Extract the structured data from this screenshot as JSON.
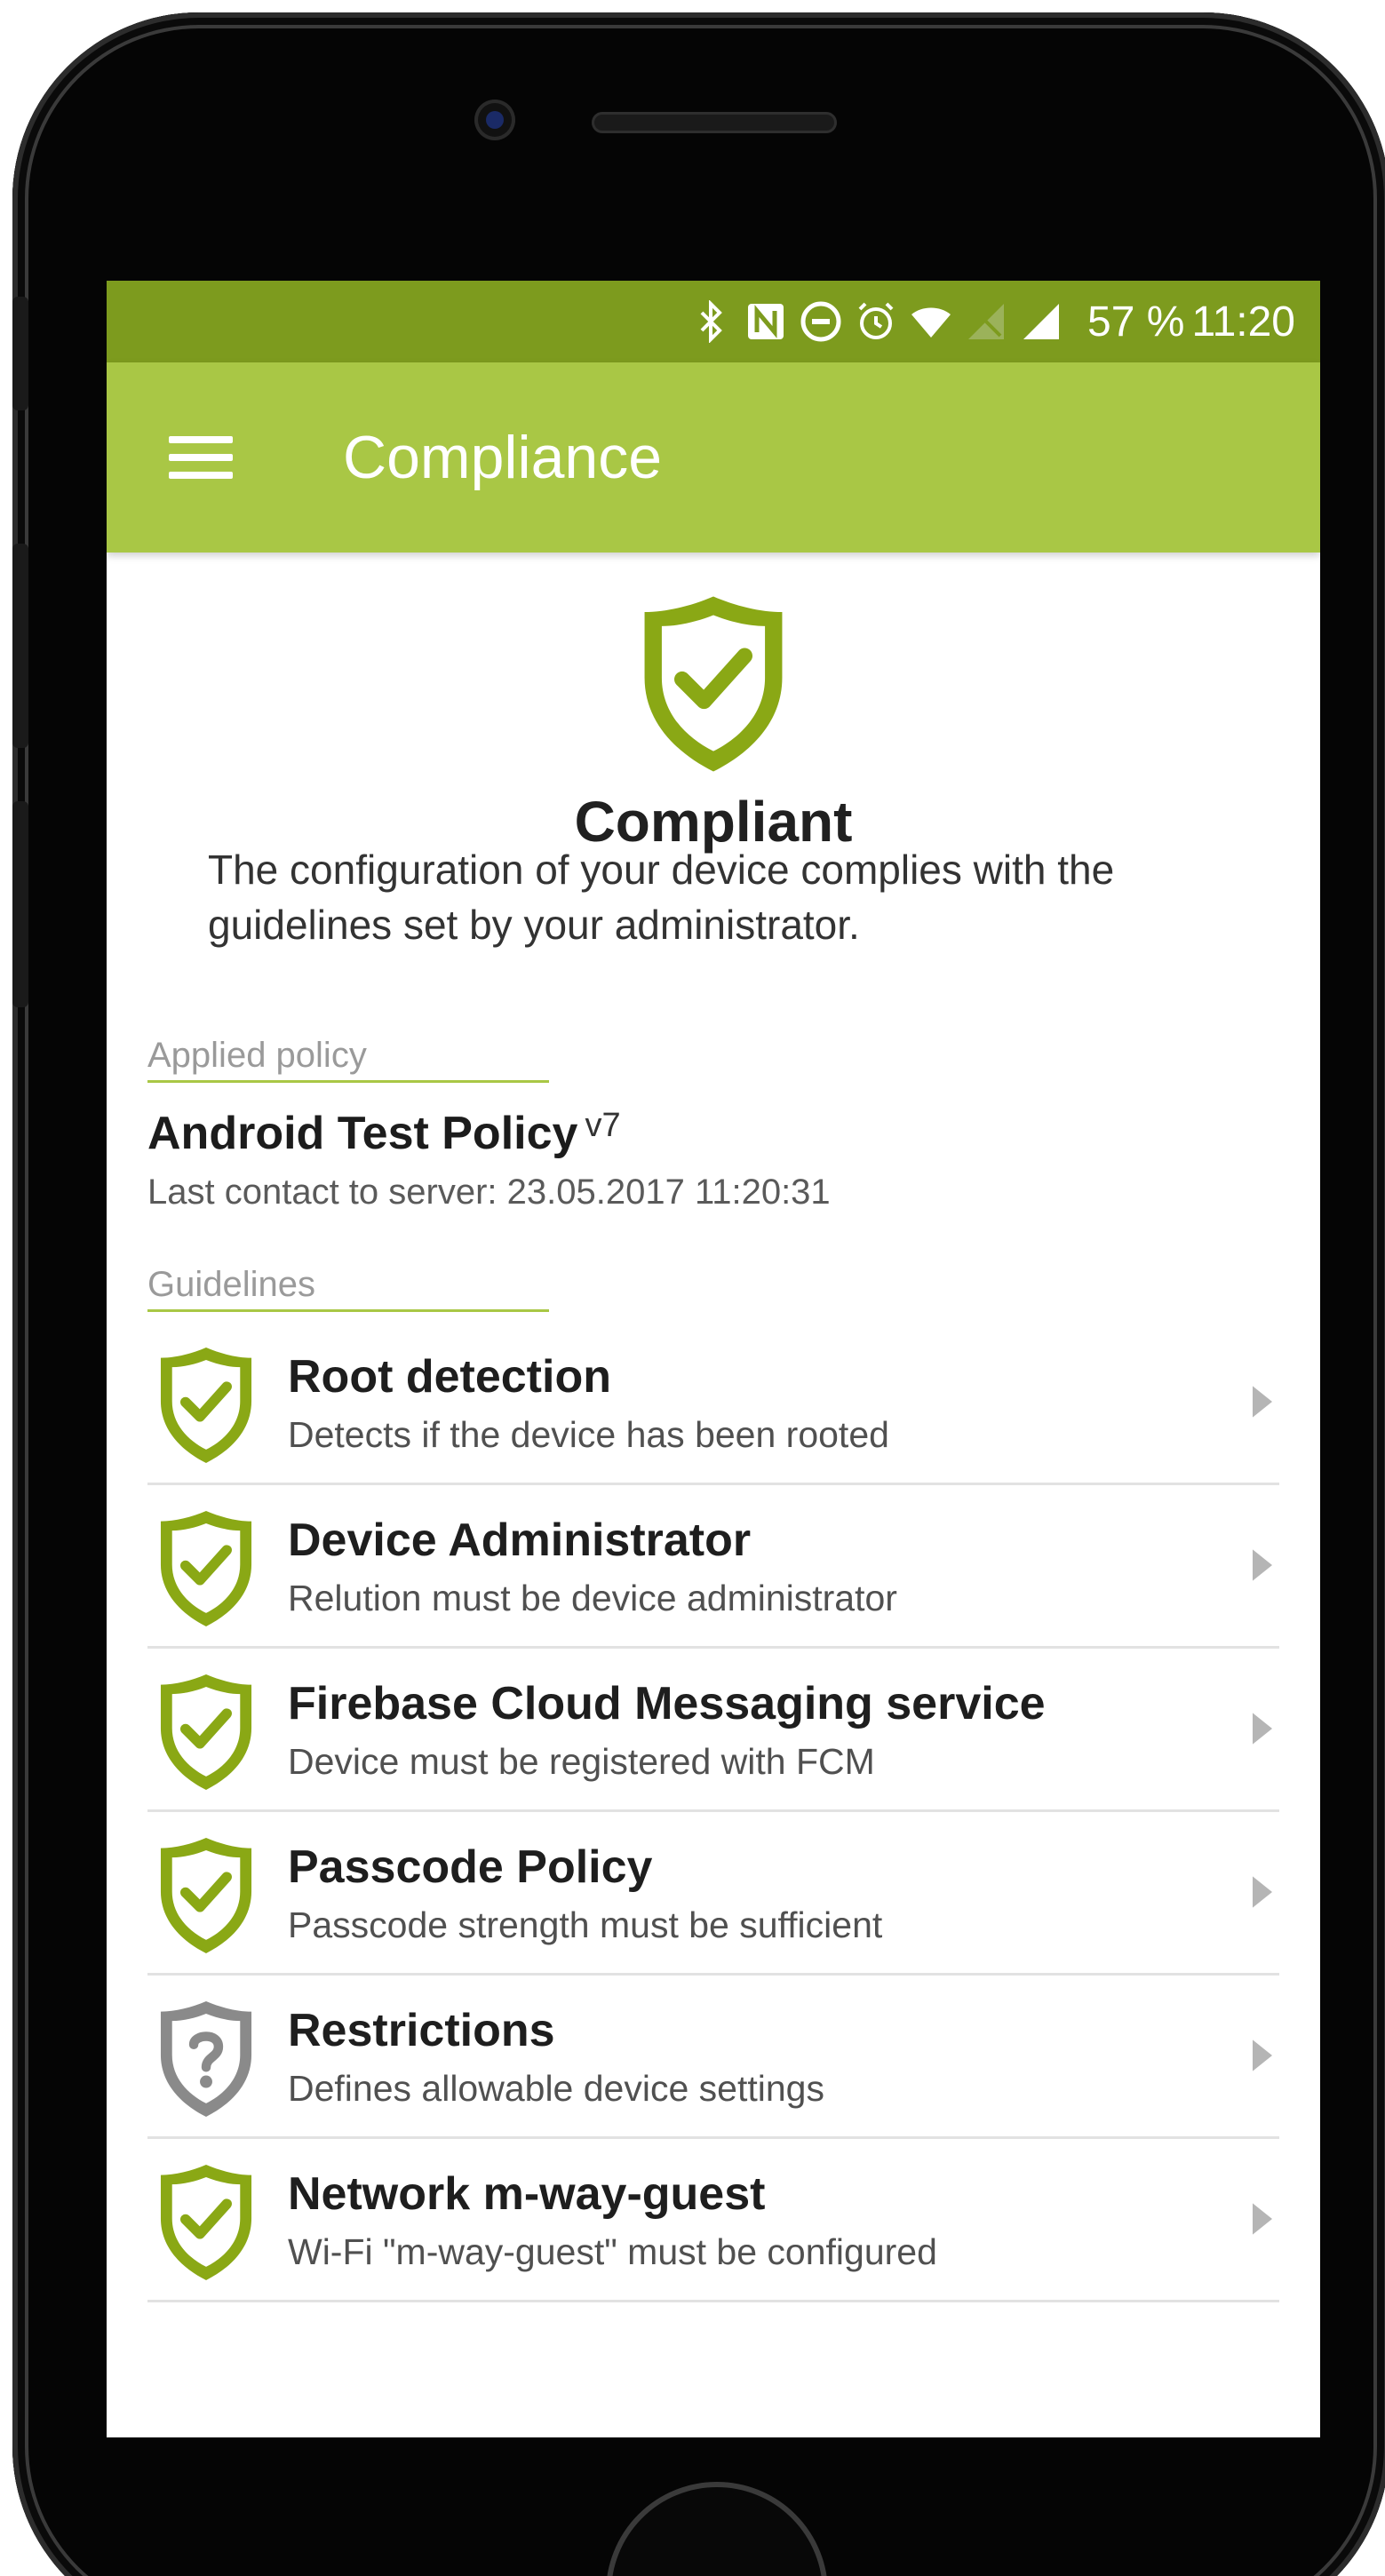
{
  "statusbar": {
    "icons": [
      "bluetooth-icon",
      "nfc-icon",
      "do-not-disturb-icon",
      "alarm-icon",
      "wifi-icon",
      "no-sim-icon",
      "cell-signal-icon"
    ],
    "battery": "57 %",
    "time": "11:20"
  },
  "appbar": {
    "title": "Compliance",
    "menu_icon": "hamburger-menu-icon"
  },
  "status": {
    "title": "Compliant",
    "description": "The configuration of your device complies with the guidelines set by your administrator.",
    "icon": "shield-check-icon"
  },
  "policy": {
    "section_label": "Applied policy",
    "name": "Android Test Policy",
    "version": "v7",
    "last_contact": "Last contact to server: 23.05.2017 11:20:31"
  },
  "guidelines": {
    "section_label": "Guidelines",
    "items": [
      {
        "title": "Root detection",
        "description": "Detects if the device has been rooted",
        "status": "compliant"
      },
      {
        "title": "Device Administrator",
        "description": "Relution must be device administrator",
        "status": "compliant"
      },
      {
        "title": "Firebase Cloud Messaging service",
        "description": "Device must be registered with FCM",
        "status": "compliant"
      },
      {
        "title": "Passcode Policy",
        "description": "Passcode strength must be sufficient",
        "status": "compliant"
      },
      {
        "title": "Restrictions",
        "description": "Defines allowable device settings",
        "status": "unknown"
      },
      {
        "title": "Network m-way-guest",
        "description": "Wi-Fi \"m-way-guest\" must be configured",
        "status": "compliant"
      }
    ]
  },
  "colors": {
    "statusbar": "#7d9b1e",
    "appbar": "#a9c745",
    "shield_ok": "#8aa815",
    "shield_unknown": "#8a8a8a"
  }
}
